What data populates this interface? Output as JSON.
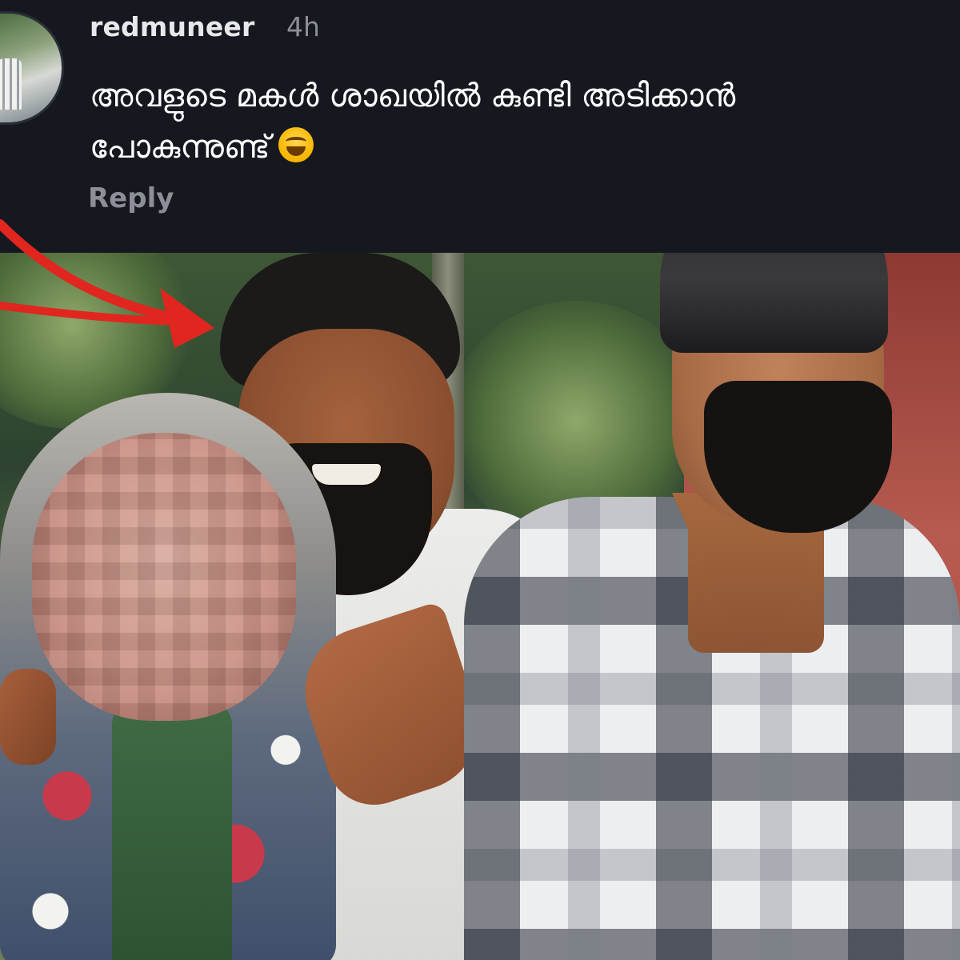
{
  "comment": {
    "username": "redmuneer",
    "time": "4h",
    "text_line1": "അവളുടെ മകൾ ശാഖയിൽ കുണ്ടി അടിക്കാൻ",
    "text_line2": "പോകുന്നുണ്ട്",
    "emoji": "face-with-tears-of-joy",
    "reply_label": "Reply"
  },
  "photo": {
    "annotation": "red-arrow",
    "arrow_color": "#e0261f",
    "censored_region": "pixelated-face"
  },
  "colors": {
    "background": "#161820",
    "username": "#e8e8ea",
    "meta": "#8c8f98",
    "comment_text": "#ffffff"
  }
}
